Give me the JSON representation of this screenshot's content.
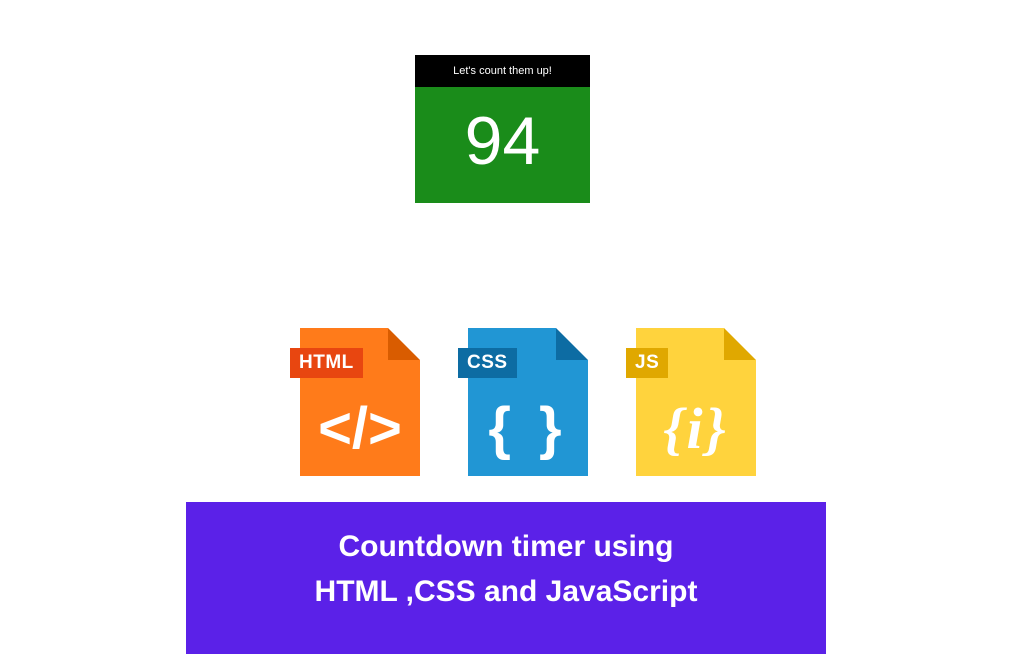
{
  "counter": {
    "header": "Let's count them up!",
    "value": "94"
  },
  "files": {
    "html": {
      "tag": "HTML",
      "symbol": "</>"
    },
    "css": {
      "tag": "CSS",
      "symbol": "{ }"
    },
    "js": {
      "tag": "JS",
      "symbol": "{i}"
    }
  },
  "banner": {
    "line1": "Countdown timer using",
    "line2": "HTML ,CSS and JavaScript"
  }
}
